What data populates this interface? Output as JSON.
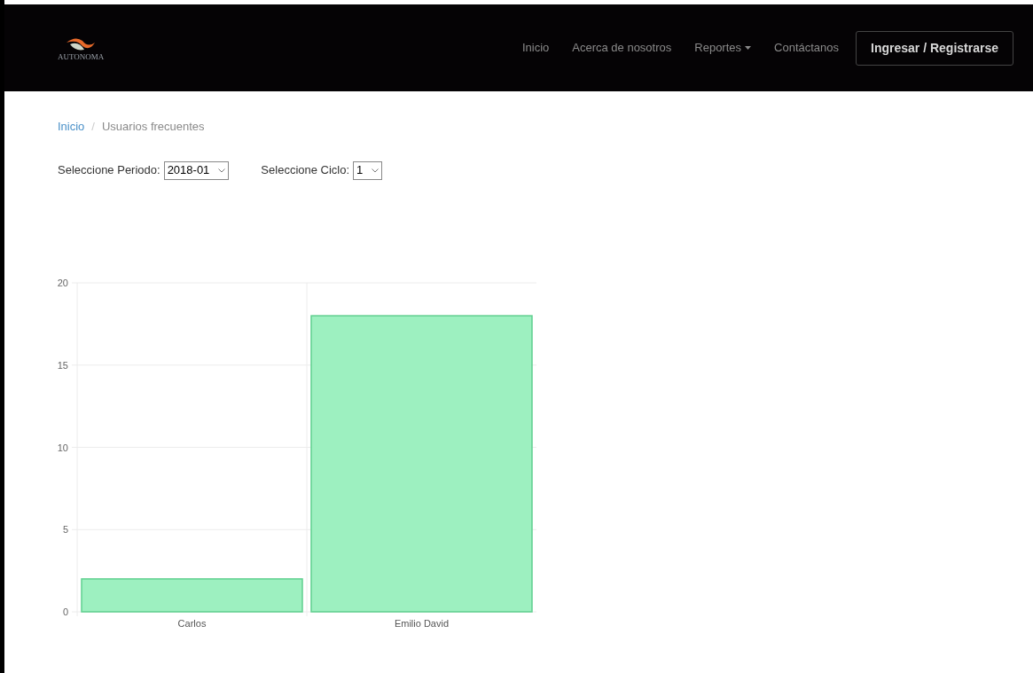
{
  "logo": {
    "text": "AUTONOMA"
  },
  "nav": {
    "items": [
      {
        "label": "Inicio",
        "kind": "link"
      },
      {
        "label": "Acerca de nosotros",
        "kind": "link"
      },
      {
        "label": "Reportes",
        "kind": "dropdown"
      },
      {
        "label": "Contáctanos",
        "kind": "link"
      }
    ],
    "login_button": "Ingresar / Registrarse"
  },
  "breadcrumb_separator": "/",
  "breadcrumb": [
    {
      "label": "Inicio",
      "selected": false
    },
    {
      "label": "Usuarios frecuentes",
      "selected": true
    }
  ],
  "filters": [
    {
      "label": "Seleccione Periodo:",
      "value": "2018-01"
    },
    {
      "label": "Seleccione Ciclo:",
      "value": "1"
    }
  ],
  "chart_data": {
    "type": "bar",
    "categories": [
      "Carlos",
      "Emilio David"
    ],
    "series": [
      {
        "color": "#9df0c0",
        "values": [
          2,
          18
        ]
      }
    ],
    "grid": true,
    "ylim": [
      0,
      20
    ],
    "yticks": [
      0,
      5,
      10,
      15,
      20
    ]
  }
}
